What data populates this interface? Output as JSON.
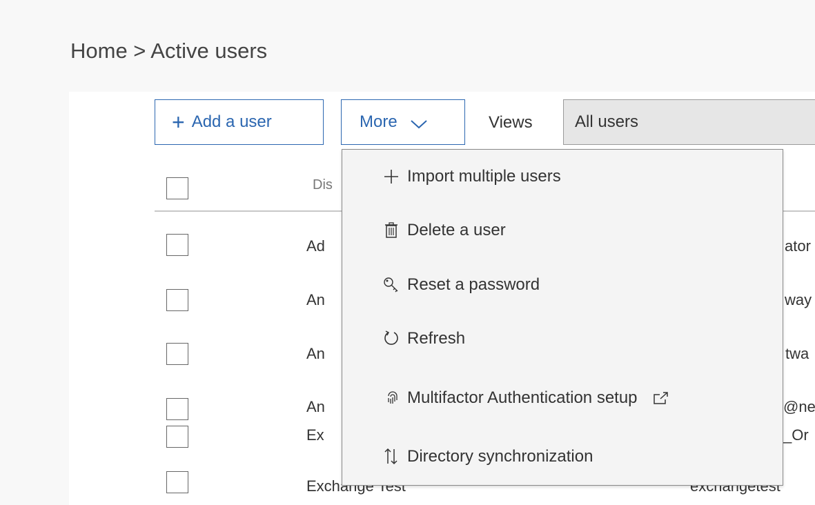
{
  "breadcrumb": {
    "text": "Home > Active users"
  },
  "toolbar": {
    "add_user_label": "Add a user",
    "more_label": "More",
    "views_label": "Views",
    "views_value": "All users"
  },
  "table": {
    "header_name": "Dis",
    "rows": [
      {
        "name": "Ad",
        "user": "ator"
      },
      {
        "name": "An",
        "user": "way"
      },
      {
        "name": "An",
        "user": "twa"
      },
      {
        "name": "An",
        "user": "@ne"
      },
      {
        "name": "Ex",
        "user": "_Or"
      },
      {
        "name": "Exchange Test",
        "user": "exchangetest"
      }
    ]
  },
  "more_menu": {
    "items": [
      {
        "label": "Import multiple users",
        "icon": "plus-icon"
      },
      {
        "label": "Delete a user",
        "icon": "trash-icon"
      },
      {
        "label": "Reset a password",
        "icon": "key-icon"
      },
      {
        "label": "Refresh",
        "icon": "refresh-icon"
      },
      {
        "label": "Multifactor Authentication setup",
        "icon": "fingerprint-icon",
        "external": "external-link-icon"
      },
      {
        "label": "Directory synchronization",
        "icon": "sync-arrows-icon"
      }
    ]
  },
  "colors": {
    "accent": "#2b66b0",
    "page_bg": "#f8f8f8",
    "select_bg": "#e6e6e6",
    "menu_bg": "#f4f4f4"
  }
}
